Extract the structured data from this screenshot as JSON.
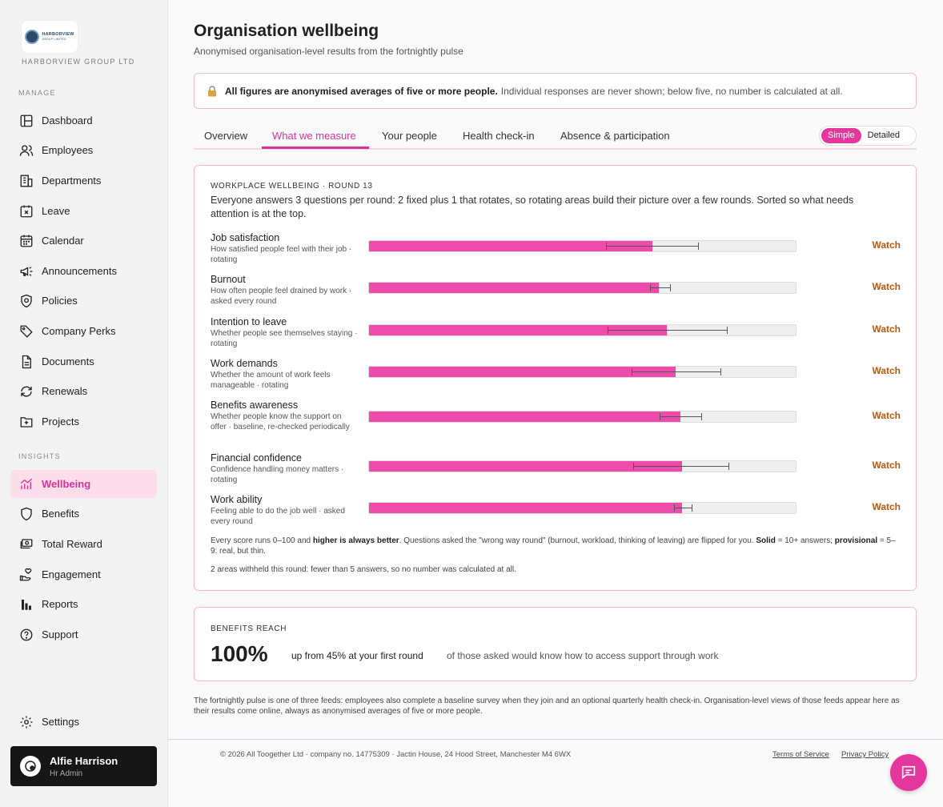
{
  "brand": {
    "logo_text": "HARBORVIEW",
    "logo_subtext": "GROUP LIMITED",
    "company_name": "HARBORVIEW GROUP LTD",
    "accent_color": "#e5369e"
  },
  "sidebar": {
    "manage_label": "MANAGE",
    "manage_items": [
      {
        "label": "Dashboard",
        "icon": "dashboard-icon"
      },
      {
        "label": "Employees",
        "icon": "users-icon"
      },
      {
        "label": "Departments",
        "icon": "building-icon"
      },
      {
        "label": "Leave",
        "icon": "calendar-x-icon"
      },
      {
        "label": "Calendar",
        "icon": "calendar-icon"
      },
      {
        "label": "Announcements",
        "icon": "megaphone-icon"
      },
      {
        "label": "Policies",
        "icon": "shield-check-icon"
      },
      {
        "label": "Company Perks",
        "icon": "tag-icon"
      },
      {
        "label": "Documents",
        "icon": "document-icon"
      },
      {
        "label": "Renewals",
        "icon": "refresh-icon"
      },
      {
        "label": "Projects",
        "icon": "folder-icon"
      }
    ],
    "insights_label": "INSIGHTS",
    "insights_items": [
      {
        "label": "Wellbeing",
        "icon": "trend-chart-icon"
      },
      {
        "label": "Benefits",
        "icon": "shield-icon"
      },
      {
        "label": "Total Reward",
        "icon": "money-icon"
      },
      {
        "label": "Engagement",
        "icon": "hand-heart-icon"
      },
      {
        "label": "Reports",
        "icon": "bar-chart-icon"
      },
      {
        "label": "Support",
        "icon": "help-icon"
      }
    ],
    "settings_label": "Settings",
    "user": {
      "name": "Alfie Harrison",
      "role": "Hr Admin"
    }
  },
  "header": {
    "title": "Organisation wellbeing",
    "subtitle": "Anonymised organisation-level results from the fortnightly pulse"
  },
  "notice": {
    "bold": "All figures are anonymised averages of five or more people.",
    "text": "Individual responses are never shown; below five, no number is calculated at all."
  },
  "tabs": [
    {
      "label": "Overview"
    },
    {
      "label": "What we measure"
    },
    {
      "label": "Your people"
    },
    {
      "label": "Health check-in"
    },
    {
      "label": "Absence & participation"
    }
  ],
  "view_toggle": {
    "simple": "Simple",
    "detailed": "Detailed"
  },
  "measures": {
    "label": "WORKPLACE WELLBEING · ROUND 13",
    "intro": "Everyone answers 3 questions per round: 2 fixed plus 1 that rotates, so rotating areas build their picture over a few rounds. Sorted so what needs attention is at the top.",
    "note_parts": {
      "a": "Every score runs 0–100 and ",
      "b": "higher is always better",
      "c": ". Questions asked the \"wrong way round\" (burnout, workload, thinking of leaving) are flipped for you. ",
      "d": "Solid",
      "e": " = 10+ answers; ",
      "f": "provisional",
      "g": " = 5–9: real, but thin."
    },
    "withheld": "2 areas withheld this round: fewer than 5 answers, so no number was calculated at all."
  },
  "chart_data": {
    "type": "bar",
    "orientation": "horizontal",
    "xlim": [
      0,
      100
    ],
    "rows": [
      {
        "title": "Job satisfaction",
        "desc": "How satisfied people feel with their job · rotating",
        "value": 66.5,
        "ci": [
          55.6,
          77.2
        ],
        "status": "Watch"
      },
      {
        "title": "Burnout",
        "desc": "How often people feel drained by work · asked every round",
        "value": 68,
        "ci": [
          65.8,
          70.5
        ],
        "status": "Watch"
      },
      {
        "title": "Intention to leave",
        "desc": "Whether people see themselves staying · rotating",
        "value": 69.8,
        "ci": [
          56,
          83.8
        ],
        "status": "Watch"
      },
      {
        "title": "Work demands",
        "desc": "Whether the amount of work feels manageable · rotating",
        "value": 71.8,
        "ci": [
          61.6,
          82.3
        ],
        "status": "Watch"
      },
      {
        "title": "Benefits awareness",
        "desc": "Whether people know the support on offer · baseline, re-checked periodically",
        "value": 73,
        "ci": [
          68.1,
          77.9
        ],
        "status": "Watch"
      },
      {
        "title": "Financial confidence",
        "desc": "Confidence handling money matters · rotating",
        "value": 73.3,
        "ci": [
          62,
          84.3
        ],
        "status": "Watch"
      },
      {
        "title": "Work ability",
        "desc": "Feeling able to do the job well · asked every round",
        "value": 73.3,
        "ci": [
          71.4,
          75.7
        ],
        "status": "Watch"
      }
    ]
  },
  "benefits_reach": {
    "label": "BENEFITS REACH",
    "value": "100%",
    "change": "up from 45% at your first round",
    "desc": "of those asked would know how to access support through work"
  },
  "footer": {
    "note": "The fortnightly pulse is one of three feeds: employees also complete a baseline survey when they join and an optional quarterly health check-in. Organisation-level views of those feeds appear here as their results come online, always as anonymised averages of five or more people.",
    "copyright": "© 2026 All Toogether Ltd · company no. 14775309 · Jactin House, 24 Hood Street, Manchester M4 6WX",
    "terms": "Terms of Service",
    "privacy": "Privacy Policy"
  }
}
